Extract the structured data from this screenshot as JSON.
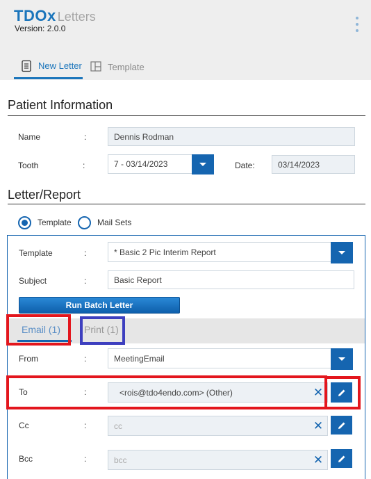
{
  "header": {
    "logo": "TDOx",
    "app_name": "Letters",
    "version": "Version: 2.0.0",
    "menu_icon": "kebab-menu-icon"
  },
  "tabs": [
    {
      "label": "New Letter",
      "icon": "document-icon",
      "active": true
    },
    {
      "label": "Template",
      "icon": "layout-icon",
      "active": false
    }
  ],
  "patient": {
    "title": "Patient Information",
    "name_label": "Name",
    "name_value": "Dennis Rodman",
    "tooth_label": "Tooth",
    "tooth_value": "7 - 03/14/2023",
    "date_label": "Date:",
    "date_value": "03/14/2023"
  },
  "letter": {
    "title": "Letter/Report",
    "radio_template": "Template",
    "radio_mailsets": "Mail Sets",
    "selected": "Template",
    "template_label": "Template",
    "template_value": "* Basic 2 Pic Interim Report",
    "subject_label": "Subject",
    "subject_value": "Basic Report",
    "run_batch": "Run Batch Letter"
  },
  "subtabs": {
    "email": "Email (1)",
    "print": "Print (1)",
    "active": "email"
  },
  "email": {
    "from_label": "From",
    "from_value": "MeetingEmail",
    "to_label": "To",
    "to_value": "<rois@tdo4endo.com> (Other)",
    "cc_label": "Cc",
    "cc_placeholder": "cc",
    "bcc_label": "Bcc",
    "bcc_placeholder": "bcc"
  },
  "colon": ":",
  "clear_glyph": "✕",
  "colors": {
    "accent": "#1565b0",
    "highlight_red": "#e3161d",
    "highlight_blue": "#3d3fbf"
  }
}
